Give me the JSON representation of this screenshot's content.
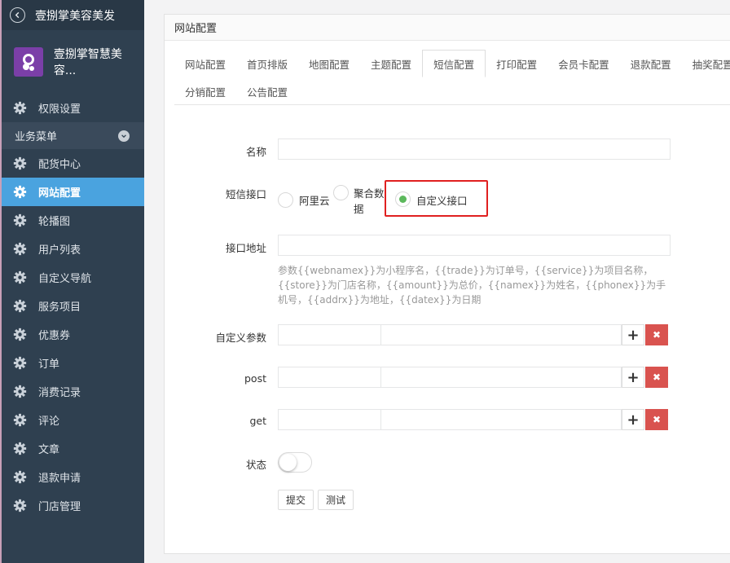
{
  "app": {
    "title": "壹捌掌美容美发",
    "profile_name": "壹捌掌智慧美容..."
  },
  "sidebar": {
    "top_item": "权限设置",
    "section": "业务菜单",
    "items": [
      "配货中心",
      "网站配置",
      "轮播图",
      "用户列表",
      "自定义导航",
      "服务项目",
      "优惠券",
      "订单",
      "消费记录",
      "评论",
      "文章",
      "退款申请",
      "门店管理"
    ],
    "active": "网站配置"
  },
  "panel": {
    "title": "网站配置"
  },
  "tabs": {
    "row1": [
      "网站配置",
      "首页排版",
      "地图配置",
      "主题配置",
      "短信配置",
      "打印配置",
      "会员卡配置",
      "退款配置",
      "抽奖配置"
    ],
    "row2": [
      "分销配置",
      "公告配置"
    ],
    "active": "短信配置"
  },
  "form": {
    "name_label": "名称",
    "name_value": "",
    "sms_label": "短信接口",
    "sms_options": [
      "阿里云",
      "聚合数",
      "据",
      "自定义接口"
    ],
    "sms_selected": "自定义接口",
    "url_label": "接口地址",
    "url_value": "",
    "help_text": "参数{{webnamex}}为小程序名，{{trade}}为订单号，{{service}}为项目名称，{{store}}为门店名称，{{amount}}为总价，{{namex}}为姓名，{{phonex}}为手机号，{{addrx}}为地址，{{datex}}为日期",
    "custom_params_label": "自定义参数",
    "post_label": "post",
    "get_label": "get",
    "status_label": "状态",
    "status_on": false,
    "submit_label": "提交",
    "test_label": "测试",
    "plus_glyph": "+",
    "delete_glyph": "✖"
  },
  "colors": {
    "sidebar_bg": "#2f4050",
    "active_bg": "#4aa3df",
    "danger": "#d9534f",
    "radio_on": "#5cb85c",
    "highlight": "#e02020"
  }
}
